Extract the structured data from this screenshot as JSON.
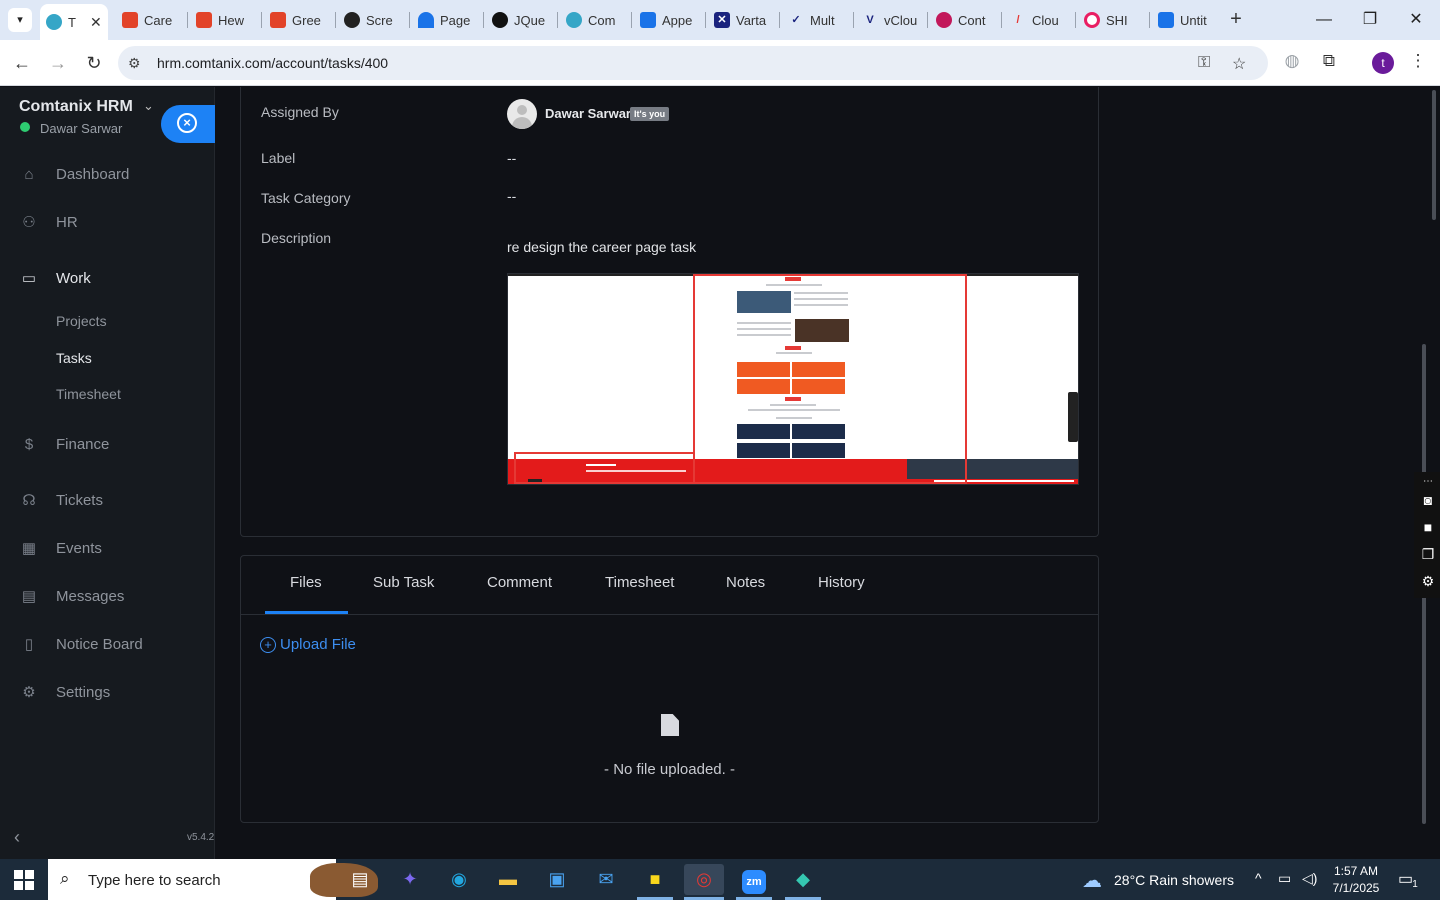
{
  "browser": {
    "tabs": [
      {
        "label": "T",
        "icon": "comtanix-icon",
        "color": "#35a6c7",
        "active": true
      },
      {
        "label": "Care",
        "icon": "gitlab-icon",
        "color": "#e24329"
      },
      {
        "label": "Hew",
        "icon": "gitlab-icon",
        "color": "#e24329"
      },
      {
        "label": "Gree",
        "icon": "gitlab-icon",
        "color": "#e24329"
      },
      {
        "label": "Scre",
        "icon": "github-icon",
        "color": "#222222"
      },
      {
        "label": "Page",
        "icon": "pagespeed-icon",
        "color": "#1a73e8"
      },
      {
        "label": "JQue",
        "icon": "openai-icon",
        "color": "#111111"
      },
      {
        "label": "Com",
        "icon": "comtanix-icon",
        "color": "#35a6c7"
      },
      {
        "label": "Appe",
        "icon": "scale-icon",
        "color": "#1a73e8"
      },
      {
        "label": "Varta",
        "icon": "varta-icon",
        "color": "#1a237e"
      },
      {
        "label": "Mult",
        "icon": "check-icon",
        "color": "#1a237e"
      },
      {
        "label": "vClou",
        "icon": "v-icon",
        "color": "#1a237e"
      },
      {
        "label": "Cont",
        "icon": "pen-icon",
        "color": "#c2185b"
      },
      {
        "label": "Clou",
        "icon": "slash-icon",
        "color": "#e53935"
      },
      {
        "label": "SHI",
        "icon": "circle-icon",
        "color": "#e91e63"
      },
      {
        "label": "Untit",
        "icon": "docs-icon",
        "color": "#1a73e8"
      }
    ],
    "url": "hrm.comtanix.com/account/tasks/400",
    "profile_initial": "t"
  },
  "sidebar": {
    "brand": "Comtanix HRM",
    "user": "Dawar Sarwar",
    "menu": [
      {
        "label": "Dashboard",
        "icon": "home-icon"
      },
      {
        "label": "HR",
        "icon": "users-icon"
      },
      {
        "label": "Work",
        "icon": "briefcase-icon",
        "open": true
      },
      {
        "label": "Finance",
        "icon": "dollar-icon"
      },
      {
        "label": "Tickets",
        "icon": "headset-icon"
      },
      {
        "label": "Events",
        "icon": "calendar-icon"
      },
      {
        "label": "Messages",
        "icon": "message-icon"
      },
      {
        "label": "Notice Board",
        "icon": "clipboard-icon"
      },
      {
        "label": "Settings",
        "icon": "gear-icon"
      }
    ],
    "work_sub": [
      {
        "label": "Projects"
      },
      {
        "label": "Tasks",
        "active": true
      },
      {
        "label": "Timesheet"
      }
    ],
    "version": "v5.4.2"
  },
  "task": {
    "fields": {
      "assigned_by_label": "Assigned By",
      "assigned_by_name": "Dawar Sarwar",
      "assigned_by_badge": "It's you",
      "label_label": "Label",
      "label_value": "--",
      "category_label": "Task Category",
      "category_value": "--",
      "description_label": "Description",
      "description_value": "re design the career page task"
    }
  },
  "tabs": {
    "items": [
      "Files",
      "Sub Task",
      "Comment",
      "Timesheet",
      "Notes",
      "History"
    ],
    "active": "Files"
  },
  "files": {
    "upload_label": "Upload File",
    "empty_text": "- No file uploaded. -"
  },
  "taskbar": {
    "search_placeholder": "Type here to search",
    "weather": "28°C  Rain showers",
    "time": "1:57 AM",
    "date": "7/1/2025",
    "notifications": "1"
  },
  "colors": {
    "accent": "#1d82f5",
    "sidebar_bg": "#161a1f",
    "main_bg": "#0f1116",
    "online": "#2ecc71"
  }
}
